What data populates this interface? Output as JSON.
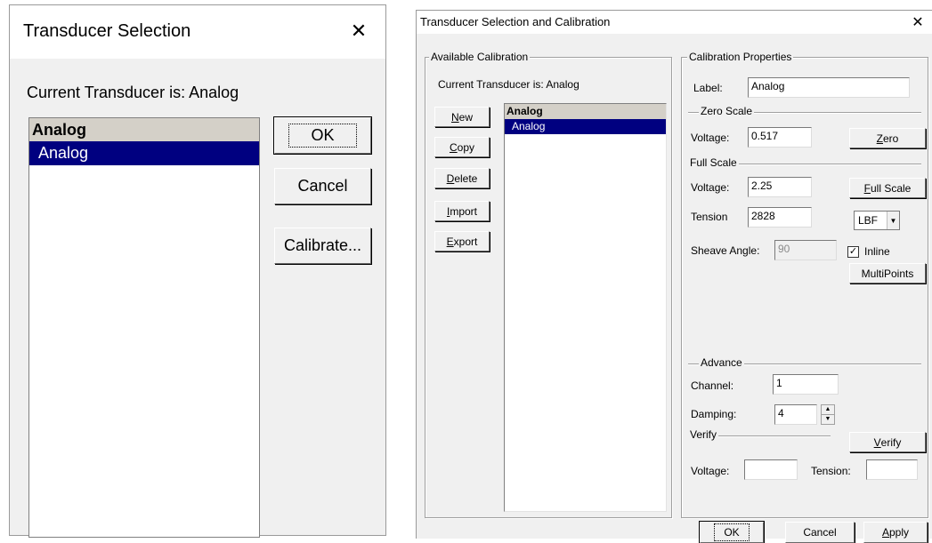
{
  "left_dialog": {
    "title": "Transducer Selection",
    "close_glyph": "✕",
    "current_text": "Current Transducer is: Analog",
    "list": {
      "header": "Analog",
      "selected": "Analog"
    },
    "buttons": {
      "ok": "OK",
      "cancel": "Cancel",
      "calibrate": "Calibrate..."
    }
  },
  "right_dialog": {
    "title": "Transducer Selection and Calibration",
    "close_glyph": "✕",
    "available_group": {
      "label": "Available Calibration",
      "current_text": "Current Transducer is: Analog",
      "buttons": [
        {
          "key": "N",
          "rest": "ew"
        },
        {
          "key": "C",
          "rest": "opy"
        },
        {
          "key": "D",
          "rest": "elete"
        },
        {
          "key": "I",
          "rest": "mport"
        },
        {
          "key": "E",
          "rest": "xport"
        }
      ],
      "list": {
        "header": "Analog",
        "selected": "Analog"
      }
    },
    "properties_group": {
      "label": "Calibration Properties",
      "label_field": {
        "label": "Label:",
        "value": "Analog"
      },
      "zero_scale": {
        "title": "Zero Scale",
        "voltage_label": "Voltage:",
        "voltage_value": "0.517",
        "button_key": "Z",
        "button_rest": "ero"
      },
      "full_scale": {
        "title": "Full Scale",
        "voltage_label": "Voltage:",
        "voltage_value": "2.25",
        "button_key": "F",
        "button_rest": "ull Scale",
        "tension_label": "Tension",
        "tension_value": "2828",
        "unit": "LBF",
        "sheave_label": "Sheave Angle:",
        "sheave_value": "90",
        "inline_label": "Inline",
        "inline_checked": true,
        "multipoints": "MultiPoints"
      },
      "advance": {
        "title": "Advance",
        "channel_label": "Channel:",
        "channel_value": "1",
        "damping_label": "Damping:",
        "damping_value": "4"
      },
      "verify": {
        "title": "Verify",
        "button_key": "V",
        "button_rest": "erify",
        "voltage_label": "Voltage:",
        "voltage_value": "",
        "tension_label": "Tension:",
        "tension_value": ""
      }
    },
    "footer": {
      "ok": "OK",
      "cancel": "Cancel",
      "apply_key": "A",
      "apply_rest": "pply"
    }
  }
}
